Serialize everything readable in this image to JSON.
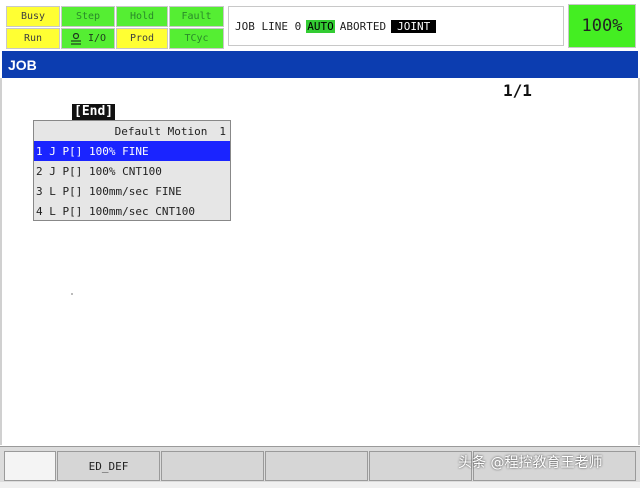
{
  "status_panel": {
    "row1": [
      {
        "label": "Busy",
        "state": "on",
        "color": "yellow"
      },
      {
        "label": "Step",
        "state": "off",
        "color": "green"
      },
      {
        "label": "Hold",
        "state": "off",
        "color": "green"
      },
      {
        "label": "Fault",
        "state": "off",
        "color": "green"
      }
    ],
    "row2": [
      {
        "label": "Run",
        "state": "on",
        "color": "yellow"
      },
      {
        "label": "I/O",
        "state": "on",
        "color": "green",
        "icon": "io-icon"
      },
      {
        "label": "Prod",
        "state": "on",
        "color": "yellow"
      },
      {
        "label": "TCyc",
        "state": "off",
        "color": "green"
      }
    ]
  },
  "top_status": {
    "program_label": "JOB LINE 0",
    "mode": "AUTO",
    "state": "ABORTED",
    "coord": "JOINT"
  },
  "override": "100%",
  "title": "JOB",
  "page_indicator": "1/1",
  "end_marker": "[End]",
  "motion_menu": {
    "header_title": "Default Motion",
    "header_number": "1",
    "items": [
      {
        "text": "1 J P[] 100% FINE",
        "selected": true
      },
      {
        "text": "2 J P[] 100% CNT100",
        "selected": false
      },
      {
        "text": "3 L P[] 100mm/sec FINE",
        "selected": false
      },
      {
        "text": "4 L P[] 100mm/sec CNT100",
        "selected": false
      }
    ]
  },
  "function_keys": [
    "",
    "ED_DEF",
    "",
    "",
    "",
    ""
  ],
  "watermark": "头条 @程控教育王老师",
  "colors": {
    "title_bar": "#0c3db0",
    "selected_row": "#1a24ff",
    "override_bg": "#44ee22",
    "status_yellow": "#ffff33",
    "status_green": "#55ee33"
  }
}
